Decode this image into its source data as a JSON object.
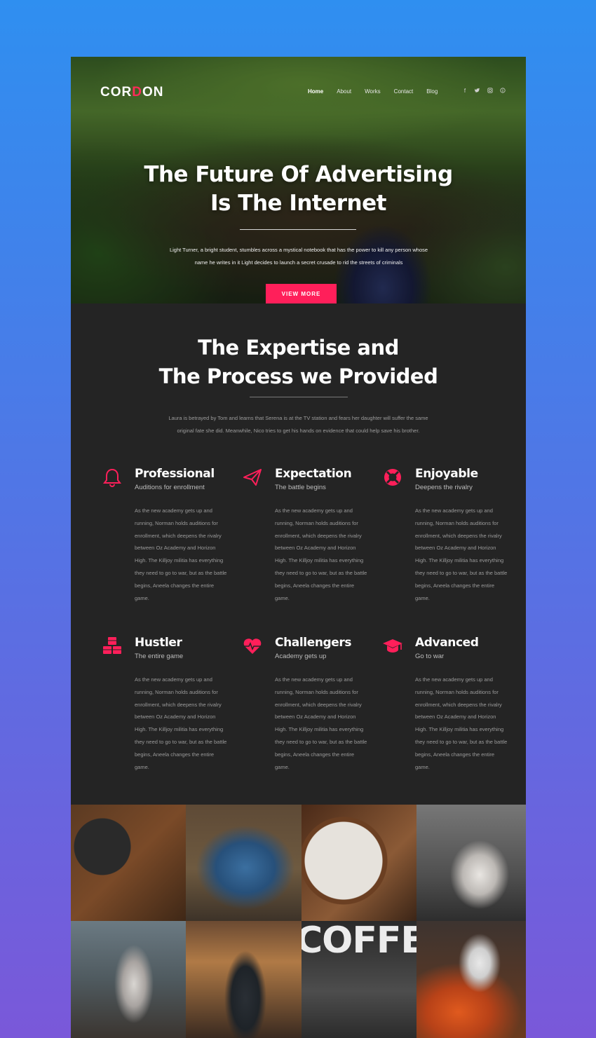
{
  "brand": {
    "logo_left": "COR",
    "logo_accent": "D",
    "logo_right": "ON",
    "accent_color": "#ff1f5a"
  },
  "nav": {
    "items": [
      "Home",
      "About",
      "Works",
      "Contact",
      "Blog"
    ],
    "active": "Home"
  },
  "social": [
    "f",
    "t",
    "ig",
    "p"
  ],
  "hero": {
    "title_line1": "The Future Of Advertising",
    "title_line2": "Is The Internet",
    "subtitle_line1": "Light Turner, a bright student, stumbles across a mystical notebook that has the power to kill any person whose",
    "subtitle_line2": "name he writes in it Light decides to launch a secret crusade to rid the streets of criminals",
    "button": "VIEW MORE"
  },
  "expertise": {
    "title_line1": "The Expertise and",
    "title_line2": "The Process we Provided",
    "subtitle_line1": "Laura is betrayed by Tom and learns that Serena is at the TV station and fears her daughter will suffer the same",
    "subtitle_line2": "original fate she did. Meanwhile, Nico tries to get his hands on evidence that could help save his brother."
  },
  "features": [
    {
      "title": "Professional",
      "subtitle": "Auditions for enrollment",
      "icon": "bell-icon",
      "body": "As the new academy gets up and running, Norman holds auditions for enrollment, which deepens the rivalry between Oz Academy and Horizon High. The Killjoy militia has everything they need to go to war, but as the battle begins, Aneela changes the entire game."
    },
    {
      "title": "Expectation",
      "subtitle": "The battle begins",
      "icon": "paper-plane-icon",
      "body": "As the new academy gets up and running, Norman holds auditions for enrollment, which deepens the rivalry between Oz Academy and Horizon High. The Killjoy militia has everything they need to go to war, but as the battle begins, Aneela changes the entire game."
    },
    {
      "title": "Enjoyable",
      "subtitle": "Deepens the rivalry",
      "icon": "lifebuoy-icon",
      "body": "As the new academy gets up and running, Norman holds auditions for enrollment, which deepens the rivalry between Oz Academy and Horizon High. The Killjoy militia has everything they need to go to war, but as the battle begins, Aneela changes the entire game."
    },
    {
      "title": "Hustler",
      "subtitle": "The entire game",
      "icon": "cubes-icon",
      "body": "As the new academy gets up and running, Norman holds auditions for enrollment, which deepens the rivalry between Oz Academy and Horizon High. The Killjoy militia has everything they need to go to war, but as the battle begins, Aneela changes the entire game."
    },
    {
      "title": "Challengers",
      "subtitle": "Academy gets up",
      "icon": "heartbeat-icon",
      "body": "As the new academy gets up and running, Norman holds auditions for enrollment, which deepens the rivalry between Oz Academy and Horizon High. The Killjoy militia has everything they need to go to war, but as the battle begins, Aneela changes the entire game."
    },
    {
      "title": "Advanced",
      "subtitle": "Go to war",
      "icon": "graduation-cap-icon",
      "body": "As the new academy gets up and running, Norman holds auditions for enrollment, which deepens the rivalry between Oz Academy and Horizon High. The Killjoy militia has everything they need to go to war, but as the battle begins, Aneela changes the entire game."
    }
  ],
  "gallery": {
    "coffee_sign": "COFFEE"
  }
}
